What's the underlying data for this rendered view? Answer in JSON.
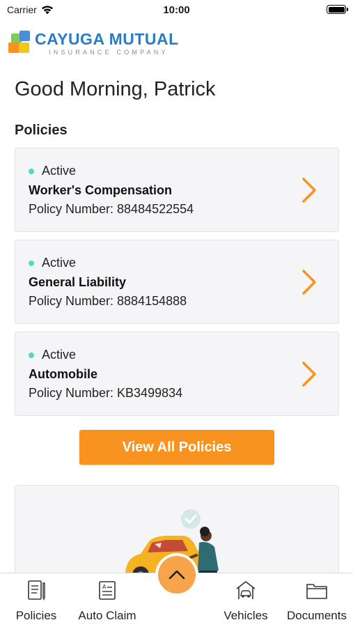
{
  "status_bar": {
    "carrier": "Carrier",
    "time": "10:00"
  },
  "brand": {
    "name": "CAYUGA MUTUAL",
    "tagline": "INSURANCE COMPANY"
  },
  "greeting": "Good Morning, Patrick",
  "policies_section": {
    "title": "Policies",
    "items": [
      {
        "status": "Active",
        "name": "Worker's Compensation",
        "number": "Policy Number: 88484522554"
      },
      {
        "status": "Active",
        "name": "General Liability",
        "number": "Policy Number: 8884154888"
      },
      {
        "status": "Active",
        "name": "Automobile",
        "number": "Policy Number: KB3499834"
      }
    ],
    "view_all_label": "View All Policies"
  },
  "tabbar": {
    "items": [
      {
        "label": "Policies",
        "icon": "document-pen-icon"
      },
      {
        "label": "Auto Claim",
        "icon": "claim-form-icon"
      },
      {
        "label": "Vehicles",
        "icon": "car-garage-icon"
      },
      {
        "label": "Documents",
        "icon": "folder-icon"
      }
    ],
    "center_icon": "chevron-up-icon"
  },
  "colors": {
    "brand_blue": "#2a7cc7",
    "accent_orange": "#f7931e",
    "active_dot": "#55d6c2",
    "card_bg": "#f5f5f7"
  }
}
